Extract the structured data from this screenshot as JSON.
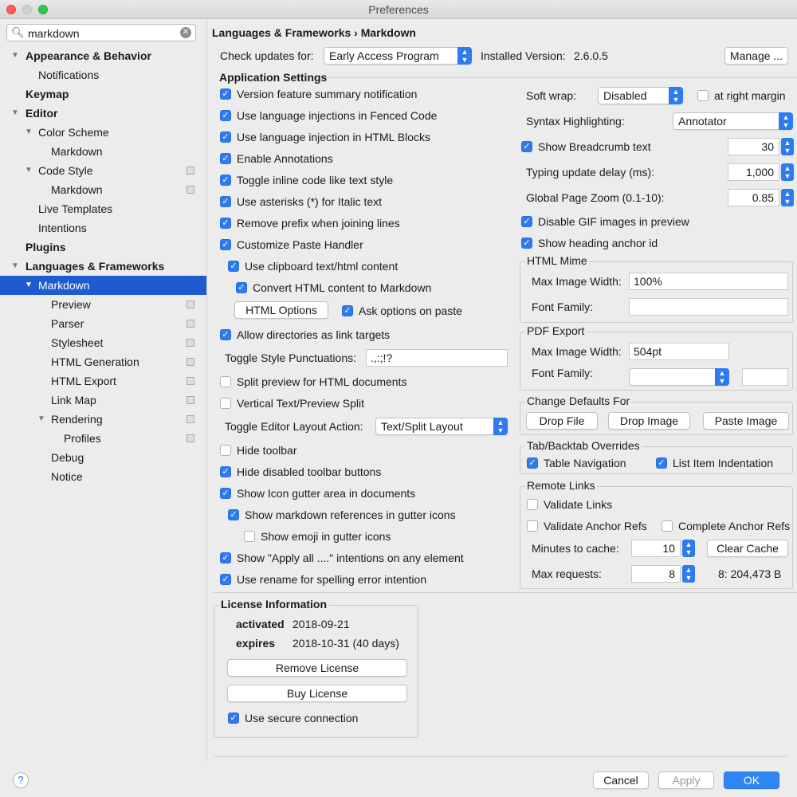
{
  "window": {
    "title": "Preferences"
  },
  "sidebar": {
    "search_value": "markdown",
    "items": [
      {
        "label": "Appearance & Behavior"
      },
      {
        "label": "Notifications"
      },
      {
        "label": "Keymap"
      },
      {
        "label": "Editor"
      },
      {
        "label": "Color Scheme"
      },
      {
        "label": "Markdown"
      },
      {
        "label": "Code Style"
      },
      {
        "label": "Markdown"
      },
      {
        "label": "Live Templates"
      },
      {
        "label": "Intentions"
      },
      {
        "label": "Plugins"
      },
      {
        "label": "Languages & Frameworks"
      },
      {
        "label": "Markdown"
      },
      {
        "label": "Preview"
      },
      {
        "label": "Parser"
      },
      {
        "label": "Stylesheet"
      },
      {
        "label": "HTML Generation"
      },
      {
        "label": "HTML Export"
      },
      {
        "label": "Link Map"
      },
      {
        "label": "Rendering"
      },
      {
        "label": "Profiles"
      },
      {
        "label": "Debug"
      },
      {
        "label": "Notice"
      }
    ]
  },
  "header": {
    "breadcrumb": "Languages & Frameworks  ›  Markdown",
    "check_updates_label": "Check updates for:",
    "check_updates_value": "Early Access Program",
    "installed_label": "Installed Version:",
    "installed_value": "2.6.0.5",
    "manage_label": "Manage ..."
  },
  "app_settings": {
    "title": "Application Settings",
    "items": [
      {
        "label": "Version feature summary notification",
        "checked": true
      },
      {
        "label": "Use language injections in Fenced Code",
        "checked": true
      },
      {
        "label": "Use language injection in HTML Blocks",
        "checked": true
      },
      {
        "label": "Enable Annotations",
        "checked": true
      },
      {
        "label": "Toggle inline code like text style",
        "checked": true
      },
      {
        "label": "Use asterisks (*) for Italic text",
        "checked": true
      },
      {
        "label": "Remove prefix when joining lines",
        "checked": true
      },
      {
        "label": "Customize Paste Handler",
        "checked": true
      },
      {
        "label": "Use clipboard text/html content",
        "checked": true
      },
      {
        "label": "Convert HTML content to Markdown",
        "checked": true
      },
      {
        "label": "Ask options on paste",
        "checked": true
      },
      {
        "label": "Allow directories as link targets",
        "checked": true
      },
      {
        "label": "Split preview for HTML documents",
        "checked": false
      },
      {
        "label": "Vertical Text/Preview Split",
        "checked": false
      },
      {
        "label": "Hide toolbar",
        "checked": false
      },
      {
        "label": "Hide disabled toolbar buttons",
        "checked": true
      },
      {
        "label": "Show Icon gutter area in documents",
        "checked": true
      },
      {
        "label": "Show markdown references in gutter icons",
        "checked": true
      },
      {
        "label": "Show emoji in gutter icons",
        "checked": false
      },
      {
        "label": "Show \"Apply all ....\" intentions on any element",
        "checked": true
      },
      {
        "label": "Use rename for spelling error intention",
        "checked": true
      }
    ],
    "html_options_label": "HTML Options",
    "punct_label": "Toggle Style Punctuations:",
    "punct_value": ".,:;!?",
    "layout_label": "Toggle Editor Layout Action:",
    "layout_value": "Text/Split Layout"
  },
  "right": {
    "soft_wrap_label": "Soft wrap:",
    "soft_wrap_value": "Disabled",
    "at_right_margin": {
      "label": "at right margin",
      "checked": false
    },
    "syntax_label": "Syntax Highlighting:",
    "syntax_value": "Annotator",
    "breadcrumb": {
      "label": "Show Breadcrumb text",
      "checked": true,
      "value": "30"
    },
    "typing_label": "Typing update delay (ms):",
    "typing_value": "1,000",
    "zoom_label": "Global Page Zoom (0.1-10):",
    "zoom_value": "0.85",
    "disable_gif": {
      "label": "Disable GIF images in preview",
      "checked": true
    },
    "heading_anchor": {
      "label": "Show heading anchor id",
      "checked": true
    },
    "html_mime": {
      "title": "HTML Mime",
      "max_width_label": "Max Image Width:",
      "max_width_value": "100%",
      "font_label": "Font Family:",
      "font_value": ""
    },
    "pdf_export": {
      "title": "PDF Export",
      "max_width_label": "Max Image Width:",
      "max_width_value": "504pt",
      "font_label": "Font Family:",
      "font_value": ""
    },
    "defaults": {
      "title": "Change Defaults For",
      "buttons": [
        "Drop File",
        "Drop Image",
        "Paste Image"
      ]
    },
    "tab_overrides": {
      "title": "Tab/Backtab Overrides",
      "table_nav": {
        "label": "Table Navigation",
        "checked": true
      },
      "list_indent": {
        "label": "List Item Indentation",
        "checked": true
      }
    },
    "remote_links": {
      "title": "Remote Links",
      "validate_links": {
        "label": "Validate Links",
        "checked": false
      },
      "validate_anchor": {
        "label": "Validate Anchor Refs",
        "checked": false
      },
      "complete_anchor": {
        "label": "Complete Anchor Refs",
        "checked": false
      },
      "minutes_label": "Minutes to cache:",
      "minutes_value": "10",
      "clear_label": "Clear Cache",
      "max_req_label": "Max requests:",
      "max_req_value": "8",
      "cache_size": "8: 204,473 B"
    }
  },
  "license": {
    "title": "License Information",
    "activated_label": "activated",
    "activated_value": "2018-09-21",
    "expires_label": "expires",
    "expires_value": "2018-10-31 (40 days)",
    "remove_label": "Remove License",
    "buy_label": "Buy License",
    "secure": {
      "label": "Use secure connection",
      "checked": true
    }
  },
  "footer": {
    "help": "?",
    "cancel": "Cancel",
    "apply": "Apply",
    "ok": "OK"
  },
  "colors": {
    "accent": "#2e7bf0",
    "selection": "#1e5bd0"
  }
}
